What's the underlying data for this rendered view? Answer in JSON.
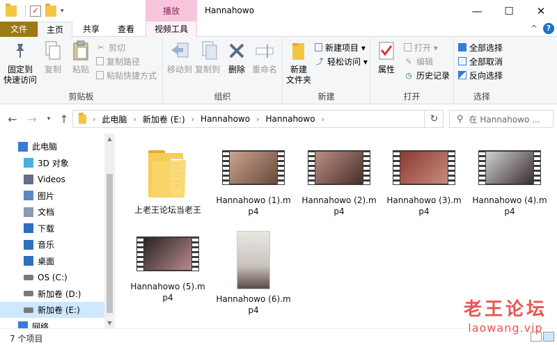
{
  "window": {
    "title": "Hannahowo",
    "context_tab_header": "播放",
    "controls": {
      "minimize": "—",
      "maximize": "☐",
      "close": "✕"
    }
  },
  "tabs": [
    {
      "label": "文件"
    },
    {
      "label": "主页"
    },
    {
      "label": "共享"
    },
    {
      "label": "查看"
    },
    {
      "label": "视频工具"
    }
  ],
  "ribbon": {
    "collapse": "^",
    "help": "?",
    "clipboard": {
      "label": "剪贴板",
      "pin": "固定到\n快速访问",
      "copy": "复制",
      "paste": "粘贴",
      "cut": "剪切",
      "copy_path": "复制路径",
      "paste_shortcut": "粘贴快捷方式"
    },
    "organize": {
      "label": "组织",
      "move_to": "移动到",
      "copy_to": "复制到",
      "delete": "删除",
      "rename": "重命名"
    },
    "new": {
      "label": "新建",
      "new_folder": "新建\n文件夹",
      "new_item": "新建项目 ▾",
      "easy_access": "轻松访问 ▾"
    },
    "open": {
      "label": "打开",
      "properties": "属性",
      "open": "打开 ▾",
      "edit": "编辑",
      "history": "历史记录"
    },
    "select": {
      "label": "选择",
      "select_all": "全部选择",
      "select_none": "全部取消",
      "invert": "反向选择"
    }
  },
  "address": {
    "breadcrumbs": [
      "此电脑",
      "新加卷 (E:)",
      "Hannahowo",
      "Hannahowo"
    ],
    "search_placeholder": "在 Hannahowo ..."
  },
  "nav_pane": {
    "items": [
      {
        "label": "此电脑",
        "icon": "computer-icon",
        "level": 0
      },
      {
        "label": "3D 对象",
        "icon": "cube-icon",
        "level": 1
      },
      {
        "label": "Videos",
        "icon": "video-icon",
        "level": 1
      },
      {
        "label": "图片",
        "icon": "picture-icon",
        "level": 1
      },
      {
        "label": "文档",
        "icon": "document-icon",
        "level": 1
      },
      {
        "label": "下载",
        "icon": "download-icon",
        "level": 1
      },
      {
        "label": "音乐",
        "icon": "music-icon",
        "level": 1
      },
      {
        "label": "桌面",
        "icon": "desktop-icon",
        "level": 1
      },
      {
        "label": "OS (C:)",
        "icon": "drive-icon",
        "level": 1
      },
      {
        "label": "新加卷 (D:)",
        "icon": "drive-icon",
        "level": 1
      },
      {
        "label": "新加卷 (E:)",
        "icon": "drive-icon",
        "level": 1,
        "selected": true
      },
      {
        "label": "网络",
        "icon": "network-icon",
        "level": 0
      }
    ]
  },
  "files": [
    {
      "name": "上老王论坛当老王",
      "type": "folder"
    },
    {
      "name": "Hannahowo (1).mp4",
      "type": "video",
      "tint": [
        "#c9a48f",
        "#6b4a3a"
      ]
    },
    {
      "name": "Hannahowo (2).mp4",
      "type": "video",
      "tint": [
        "#b98f84",
        "#4a2e2a"
      ]
    },
    {
      "name": "Hannahowo (3).mp4",
      "type": "video",
      "tint": [
        "#8a3a33",
        "#c98c7c"
      ]
    },
    {
      "name": "Hannahowo (4).mp4",
      "type": "video",
      "tint": [
        "#cfd0d2",
        "#3a2d33"
      ]
    },
    {
      "name": "Hannahowo (5).mp4",
      "type": "video",
      "tint": [
        "#2a2222",
        "#b88a8e"
      ]
    },
    {
      "name": "Hannahowo (6).mp4",
      "type": "video-portrait",
      "tint": [
        "#e9e6e2",
        "#5a4a44"
      ]
    }
  ],
  "status": {
    "count": "7 个项目"
  },
  "watermark": {
    "cn": "老王论坛",
    "en": "laowang.vip"
  }
}
